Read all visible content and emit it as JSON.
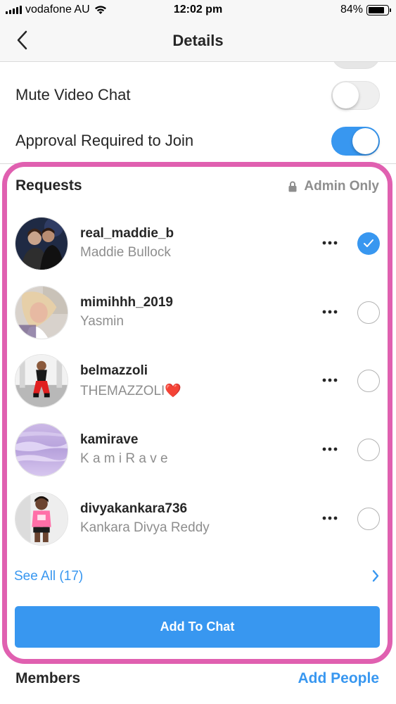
{
  "status_bar": {
    "carrier": "vodafone AU",
    "time": "12:02 pm",
    "battery": "84%",
    "battery_level": 0.84,
    "signal_icon": "signal-icon",
    "wifi_icon": "wifi-icon",
    "battery_icon": "battery-icon"
  },
  "nav": {
    "title": "Details",
    "back_icon": "chevron-left-icon"
  },
  "settings": [
    {
      "label": "Mute Video Chat",
      "on": false
    },
    {
      "label": "Approval Required to Join",
      "on": true
    }
  ],
  "requests": {
    "title": "Requests",
    "admin_label": "Admin Only",
    "lock_icon": "lock-icon",
    "items": [
      {
        "username": "real_maddie_b",
        "name": "Maddie Bullock",
        "selected": true
      },
      {
        "username": "mimihhh_2019",
        "name": "Yasmin",
        "selected": false
      },
      {
        "username": "belmazzoli",
        "name": "THEMAZZOLI❤️",
        "selected": false
      },
      {
        "username": "kamirave",
        "name": "K a m i R a v e",
        "selected": false
      },
      {
        "username": "divyakankara736",
        "name": "Kankara Divya Reddy",
        "selected": false
      }
    ],
    "see_all": "See All (17)",
    "add_button": "Add To Chat"
  },
  "members": {
    "title": "Members",
    "add_people": "Add People"
  },
  "colors": {
    "accent": "#3897f0",
    "highlight": "#e060b0",
    "secondary_text": "#8e8e8e"
  }
}
